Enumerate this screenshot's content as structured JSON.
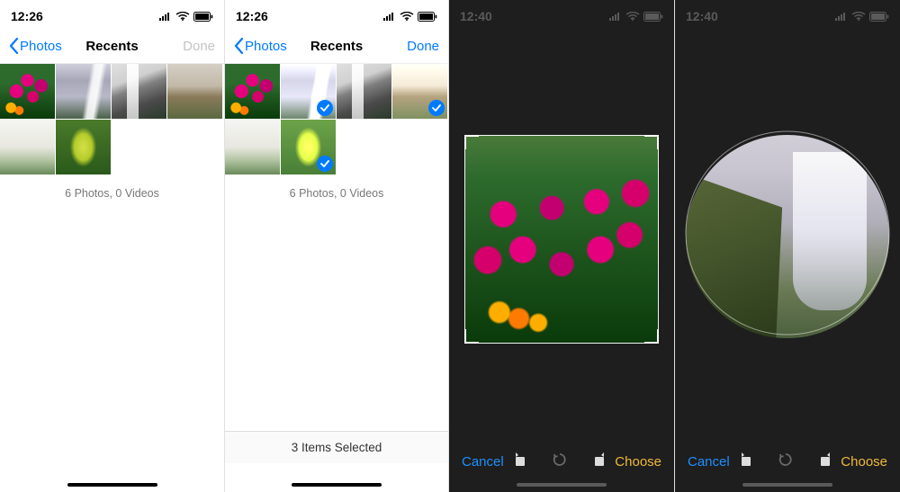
{
  "panels": [
    {
      "statusbar": {
        "time": "12:26"
      },
      "nav": {
        "back": "Photos",
        "title": "Recents",
        "done": "Done",
        "done_enabled": false
      },
      "summary": "6 Photos, 0 Videos",
      "thumbs": [
        {
          "name": "flowers",
          "selected": false
        },
        {
          "name": "waterfall-mist",
          "selected": false
        },
        {
          "name": "rocky-falls",
          "selected": false
        },
        {
          "name": "panorama",
          "selected": false
        },
        {
          "name": "hazy",
          "selected": false
        },
        {
          "name": "greenleaf",
          "selected": false
        }
      ]
    },
    {
      "statusbar": {
        "time": "12:26"
      },
      "nav": {
        "back": "Photos",
        "title": "Recents",
        "done": "Done",
        "done_enabled": true
      },
      "summary": "6 Photos, 0 Videos",
      "bottombar": "3 Items Selected",
      "thumbs": [
        {
          "name": "flowers",
          "selected": false
        },
        {
          "name": "waterfall-mist",
          "selected": true
        },
        {
          "name": "rocky-falls",
          "selected": false
        },
        {
          "name": "panorama",
          "selected": true
        },
        {
          "name": "hazy",
          "selected": false
        },
        {
          "name": "greenleaf",
          "selected": true
        }
      ]
    },
    {
      "statusbar": {
        "time": "12:40"
      },
      "toolbar": {
        "cancel": "Cancel",
        "choose": "Choose"
      },
      "image": "flowers",
      "crop": "square"
    },
    {
      "statusbar": {
        "time": "12:40"
      },
      "toolbar": {
        "cancel": "Cancel",
        "choose": "Choose"
      },
      "image": "waterfall",
      "crop": "circle"
    }
  ]
}
